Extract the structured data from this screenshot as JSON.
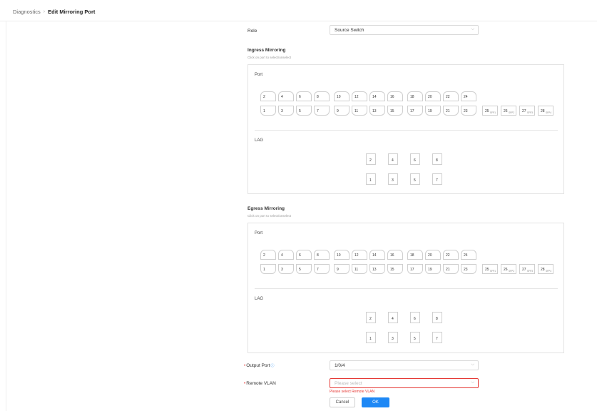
{
  "breadcrumb": {
    "parent": "Diagnostics",
    "current": "Edit Mirroring Port"
  },
  "role": {
    "label": "Role",
    "value": "Source Switch"
  },
  "ingress": {
    "title": "Ingress Mirroring",
    "hint": "Click on port to select/unselect",
    "port_label": "Port",
    "lag_label": "LAG"
  },
  "egress": {
    "title": "Egress Mirroring",
    "hint": "Click on port to select/unselect",
    "port_label": "Port",
    "lag_label": "LAG"
  },
  "ports": {
    "top_row": [
      "2",
      "4",
      "6",
      "8",
      "10",
      "12",
      "14",
      "16",
      "18",
      "20",
      "22",
      "24"
    ],
    "bottom_row": [
      "1",
      "3",
      "5",
      "7",
      "9",
      "11",
      "13",
      "15",
      "17",
      "19",
      "21",
      "23"
    ],
    "sfp": [
      {
        "num": "25",
        "tag": "SFP1"
      },
      {
        "num": "26",
        "tag": "SFP2"
      },
      {
        "num": "27",
        "tag": "SFP3"
      },
      {
        "num": "28",
        "tag": "SFP4"
      }
    ]
  },
  "lags": {
    "top": [
      "2",
      "4",
      "6",
      "8"
    ],
    "bottom": [
      "1",
      "3",
      "5",
      "7"
    ]
  },
  "output_port": {
    "label": "Output Port",
    "value": "1/0/4"
  },
  "remote_vlan": {
    "label": "Remote VLAN",
    "placeholder": "Please select",
    "error": "Please select Remote VLAN"
  },
  "buttons": {
    "cancel": "Cancel",
    "ok": "OK"
  },
  "colors": {
    "primary": "#1e88f5",
    "error": "#e53935"
  }
}
